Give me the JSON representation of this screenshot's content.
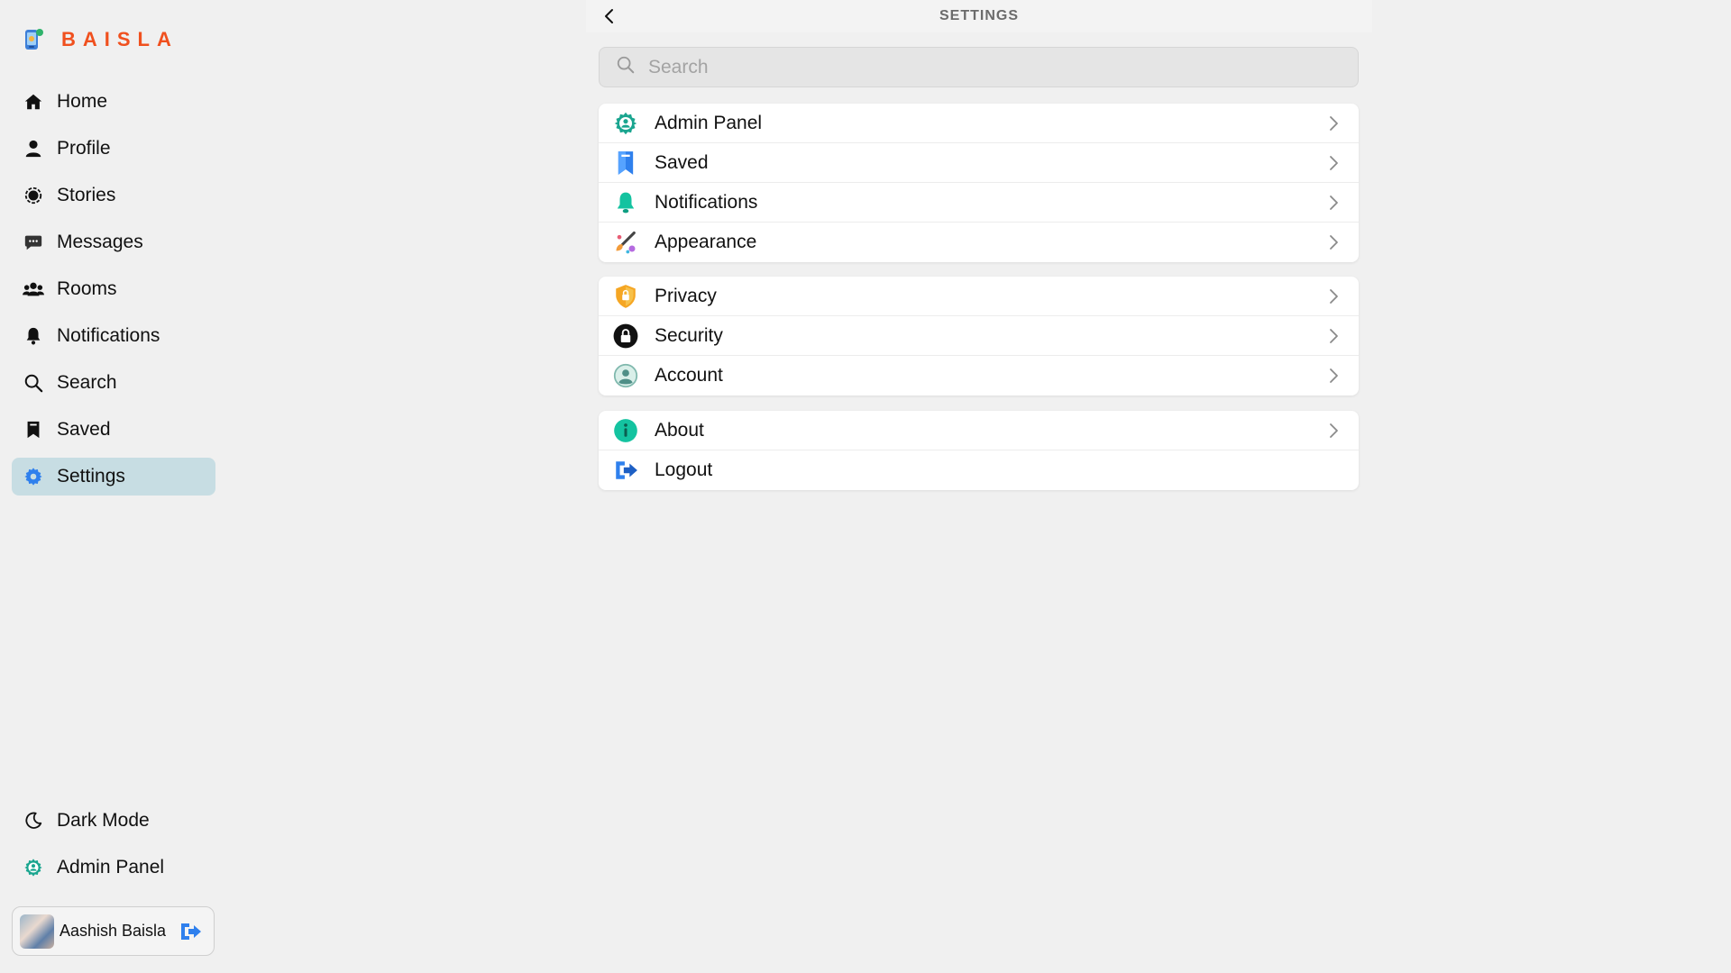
{
  "brand": {
    "name": "BAISLA",
    "color": "#f0501e"
  },
  "sidebar": {
    "items": [
      {
        "label": "Home",
        "icon": "home-icon"
      },
      {
        "label": "Profile",
        "icon": "profile-icon"
      },
      {
        "label": "Stories",
        "icon": "stories-icon"
      },
      {
        "label": "Messages",
        "icon": "messages-icon"
      },
      {
        "label": "Rooms",
        "icon": "rooms-icon"
      },
      {
        "label": "Notifications",
        "icon": "bell-icon"
      },
      {
        "label": "Search",
        "icon": "search-icon"
      },
      {
        "label": "Saved",
        "icon": "bookmark-icon"
      },
      {
        "label": "Settings",
        "icon": "gear-icon",
        "active": true
      }
    ],
    "bottom": [
      {
        "label": "Dark Mode",
        "icon": "moon-icon"
      },
      {
        "label": "Admin Panel",
        "icon": "admin-icon"
      }
    ],
    "user": {
      "name": "Aashish Baisla"
    }
  },
  "header": {
    "title": "SETTINGS"
  },
  "search": {
    "placeholder": "Search",
    "value": ""
  },
  "groups": [
    [
      {
        "label": "Admin Panel",
        "icon": "admin-icon"
      },
      {
        "label": "Saved",
        "icon": "bookmark-icon"
      },
      {
        "label": "Notifications",
        "icon": "bell-icon"
      },
      {
        "label": "Appearance",
        "icon": "paint-brush-icon"
      }
    ],
    [
      {
        "label": "Privacy",
        "icon": "shield-lock-icon"
      },
      {
        "label": "Security",
        "icon": "lock-icon"
      },
      {
        "label": "Account",
        "icon": "user-circle-icon"
      }
    ],
    [
      {
        "label": "About",
        "icon": "info-icon"
      },
      {
        "label": "Logout",
        "icon": "logout-icon"
      }
    ]
  ],
  "colors": {
    "active_nav": "#c7dde3",
    "teal": "#1aa58f",
    "blue": "#2f80ed",
    "background": "#f0f0f0"
  }
}
